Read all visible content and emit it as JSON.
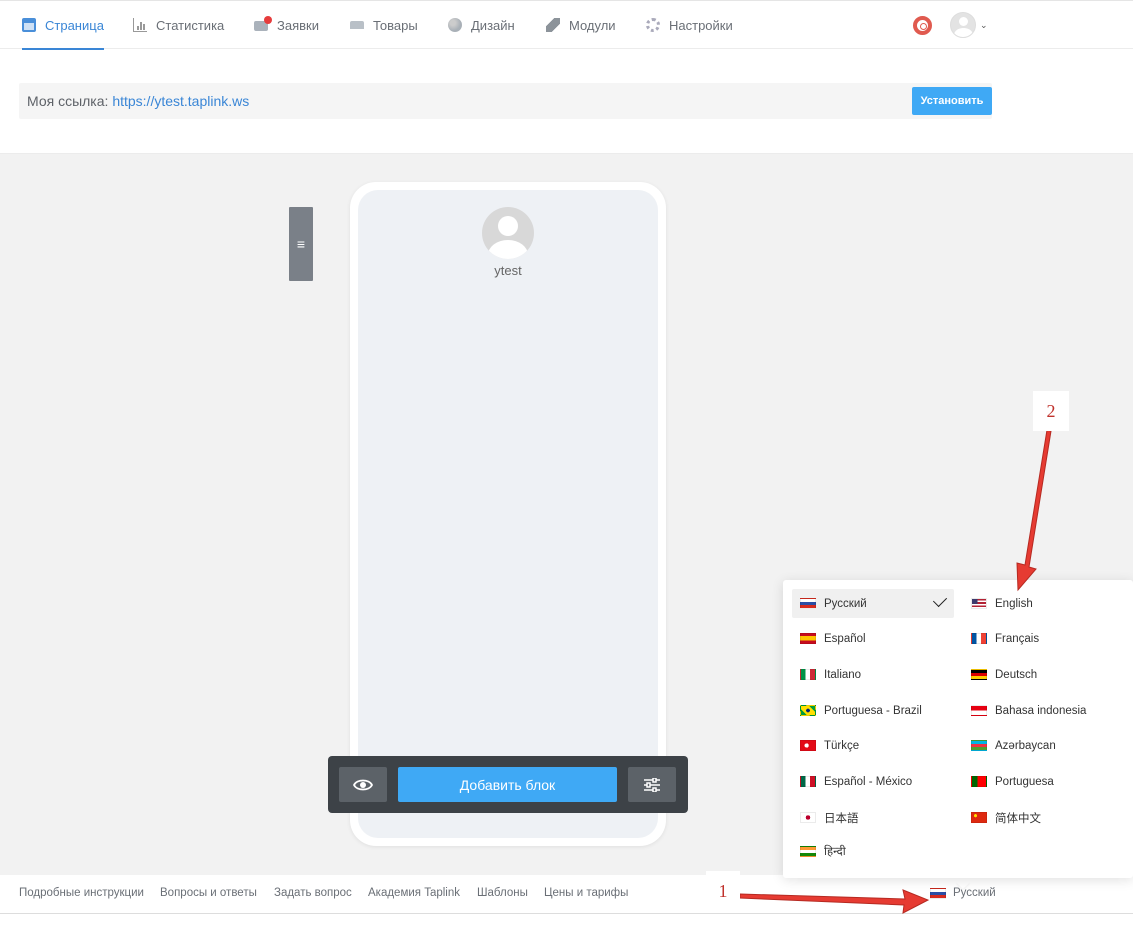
{
  "nav": {
    "items": [
      {
        "label": "Страница",
        "icon": "page-icon"
      },
      {
        "label": "Статистика",
        "icon": "stats-icon"
      },
      {
        "label": "Заявки",
        "icon": "orders-icon"
      },
      {
        "label": "Товары",
        "icon": "goods-icon"
      },
      {
        "label": "Дизайн",
        "icon": "palette-icon"
      },
      {
        "label": "Модули",
        "icon": "layers-icon"
      },
      {
        "label": "Настройки",
        "icon": "gear-icon"
      }
    ],
    "active": "Страница"
  },
  "linkbar": {
    "label": "Моя ссылка: ",
    "url": "https://ytest.taplink.ws",
    "install_label": "Установить"
  },
  "phone": {
    "username": "ytest"
  },
  "toolbar": {
    "add_block_label": "Добавить блок"
  },
  "footer": {
    "links": [
      "Подробные инструкции",
      "Вопросы и ответы",
      "Задать вопрос",
      "Академия Taplink",
      "Шаблоны",
      "Цены и тарифы"
    ],
    "language": "Русский"
  },
  "languages": {
    "left": [
      "Русский",
      "Español",
      "Italiano",
      "Portuguesa - Brazil",
      "Türkçe",
      "Español - México",
      "日本語",
      "हिन्दी"
    ],
    "right": [
      "English",
      "Français",
      "Deutsch",
      "Bahasa indonesia",
      "Azərbaycan",
      "Portuguesa",
      "简体中文"
    ],
    "selected": "Русский"
  },
  "annotations": {
    "one": "1",
    "two": "2"
  },
  "colors": {
    "accent": "#3a86d6",
    "button": "#3fa9f5",
    "annotation": "#c0322c"
  }
}
